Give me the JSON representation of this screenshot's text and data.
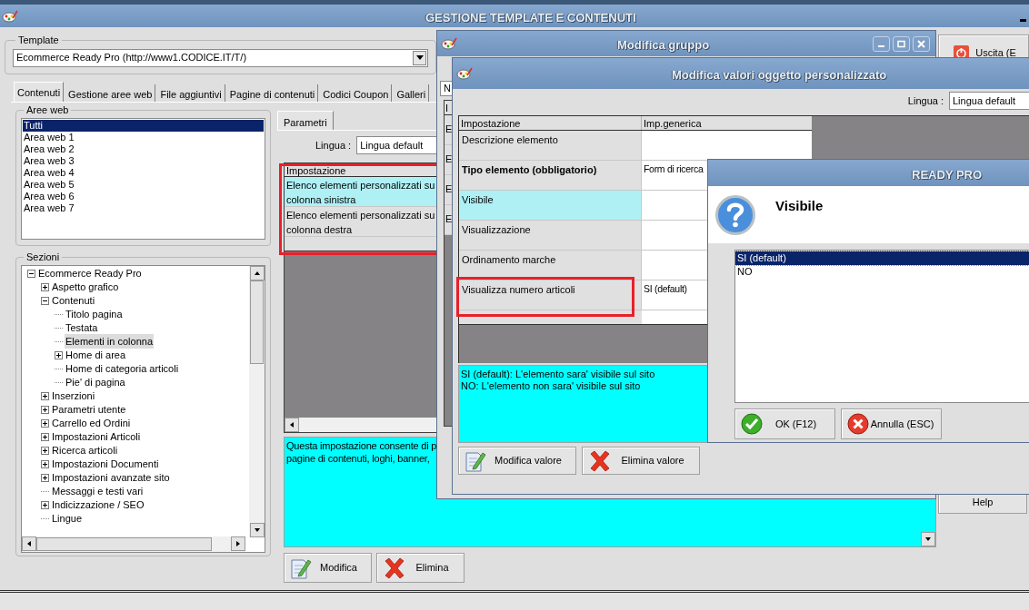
{
  "main_window": {
    "title": "GESTIONE TEMPLATE E CONTENUTI"
  },
  "template": {
    "label": "Template",
    "value": "Ecommerce Ready Pro (http://www1.CODICE.IT/T/)"
  },
  "tabs": [
    {
      "label": "Contenuti",
      "selected": true
    },
    {
      "label": "Gestione aree web",
      "selected": false
    },
    {
      "label": "File aggiuntivi",
      "selected": false
    },
    {
      "label": "Pagine di contenuti",
      "selected": false
    },
    {
      "label": "Codici Coupon",
      "selected": false
    },
    {
      "label": "Galleri",
      "selected": false
    }
  ],
  "aree_web": {
    "label": "Aree web",
    "items": [
      {
        "label": "Tutti",
        "selected": true
      },
      {
        "label": "Area web 1",
        "selected": false
      },
      {
        "label": "Area web 2",
        "selected": false
      },
      {
        "label": "Area web 3",
        "selected": false
      },
      {
        "label": "Area web 4",
        "selected": false
      },
      {
        "label": "Area web 5",
        "selected": false
      },
      {
        "label": "Area web 6",
        "selected": false
      },
      {
        "label": "Area web 7",
        "selected": false
      }
    ]
  },
  "sezioni": {
    "label": "Sezioni",
    "tree": [
      {
        "label": "Ecommerce Ready Pro",
        "selected": false,
        "expanded": true,
        "children": [
          {
            "label": "Aspetto grafico",
            "selected": false,
            "expanded": false
          },
          {
            "label": "Contenuti",
            "selected": false,
            "expanded": true,
            "children": [
              {
                "label": "Titolo pagina",
                "selected": false
              },
              {
                "label": "Testata",
                "selected": false
              },
              {
                "label": "Elementi in colonna",
                "selected": true
              },
              {
                "label": "Home di area",
                "selected": false,
                "expanded": false
              },
              {
                "label": "Home di categoria articoli",
                "selected": false
              },
              {
                "label": "Pie' di pagina",
                "selected": false
              }
            ]
          },
          {
            "label": "Inserzioni",
            "selected": false,
            "expanded": false
          },
          {
            "label": "Parametri utente",
            "selected": false,
            "expanded": false
          },
          {
            "label": "Carrello ed Ordini",
            "selected": false,
            "expanded": false
          },
          {
            "label": "Impostazioni Articoli",
            "selected": false,
            "expanded": false
          },
          {
            "label": "Ricerca articoli",
            "selected": false,
            "expanded": false
          },
          {
            "label": "Impostazioni Documenti",
            "selected": false,
            "expanded": false
          },
          {
            "label": "Impostazioni avanzate sito",
            "selected": false,
            "expanded": false
          },
          {
            "label": "Messaggi e testi vari",
            "selected": false
          },
          {
            "label": "Indicizzazione / SEO",
            "selected": false,
            "expanded": false
          },
          {
            "label": "Lingue",
            "selected": false
          }
        ]
      }
    ]
  },
  "parametri": {
    "tab": "Parametri",
    "lingua_label": "Lingua :",
    "lingua_value": "Lingua default",
    "grid_header": "Impostazione",
    "highlighted": true,
    "rows": [
      {
        "text": "Elenco elementi personalizzati su colonna sinistra",
        "selected": true
      },
      {
        "text": "Elenco elementi personalizzati su colonna destra",
        "selected": false
      }
    ],
    "description": [
      "Questa impostazione consente di p",
      "pagine di contenuti, loghi, banner,"
    ],
    "buttons": [
      {
        "label": "Modifica",
        "kind": "edit"
      },
      {
        "label": "Elimina",
        "kind": "delete"
      }
    ]
  },
  "side_buttons": [
    {
      "label": "Uscita (E",
      "kind": "exit"
    },
    {
      "label": "Help",
      "kind": "plain"
    }
  ],
  "modifica_gruppo": {
    "title": "Modifica gruppo",
    "field": "N",
    "grid_header": "I",
    "rows": [
      "E",
      "E",
      "E",
      "E"
    ]
  },
  "modifica_valori": {
    "title": "Modifica valori oggetto personalizzato",
    "lingua_label": "Lingua :",
    "lingua_value": "Lingua default",
    "columns": [
      "Impostazione",
      "Imp.generica"
    ],
    "rows": [
      {
        "setting": "Descrizione elemento",
        "bold": false,
        "selected": false,
        "highlighted": false
      },
      {
        "setting": "Tipo elemento (obbligatorio)",
        "value": "Form di ricerca",
        "bold": true,
        "selected": false,
        "highlighted": false
      },
      {
        "setting": "Visibile",
        "bold": false,
        "selected": true,
        "highlighted": false
      },
      {
        "setting": "Visualizzazione",
        "bold": false,
        "selected": false,
        "highlighted": false
      },
      {
        "setting": "Ordinamento marche",
        "bold": false,
        "selected": false,
        "highlighted": false
      },
      {
        "setting": "Visualizza numero articoli",
        "value": "SI (default)",
        "bold": false,
        "selected": false,
        "highlighted": true
      }
    ],
    "description": [
      "SI (default): L'elemento sara' visibile sul sito",
      "NO: L'elemento non sara' visibile sul sito"
    ],
    "buttons": [
      {
        "label": "Modifica valore",
        "kind": "edit"
      },
      {
        "label": "Elimina valore",
        "kind": "delete"
      }
    ]
  },
  "ready_pro": {
    "title": "READY PRO",
    "heading": "Visibile",
    "options": [
      {
        "label": "SI (default)",
        "selected": true
      },
      {
        "label": "NO",
        "selected": false
      }
    ],
    "buttons": [
      {
        "label": "OK (F12)",
        "kind": "ok"
      },
      {
        "label": "Annulla (ESC)",
        "kind": "cancel"
      }
    ]
  }
}
